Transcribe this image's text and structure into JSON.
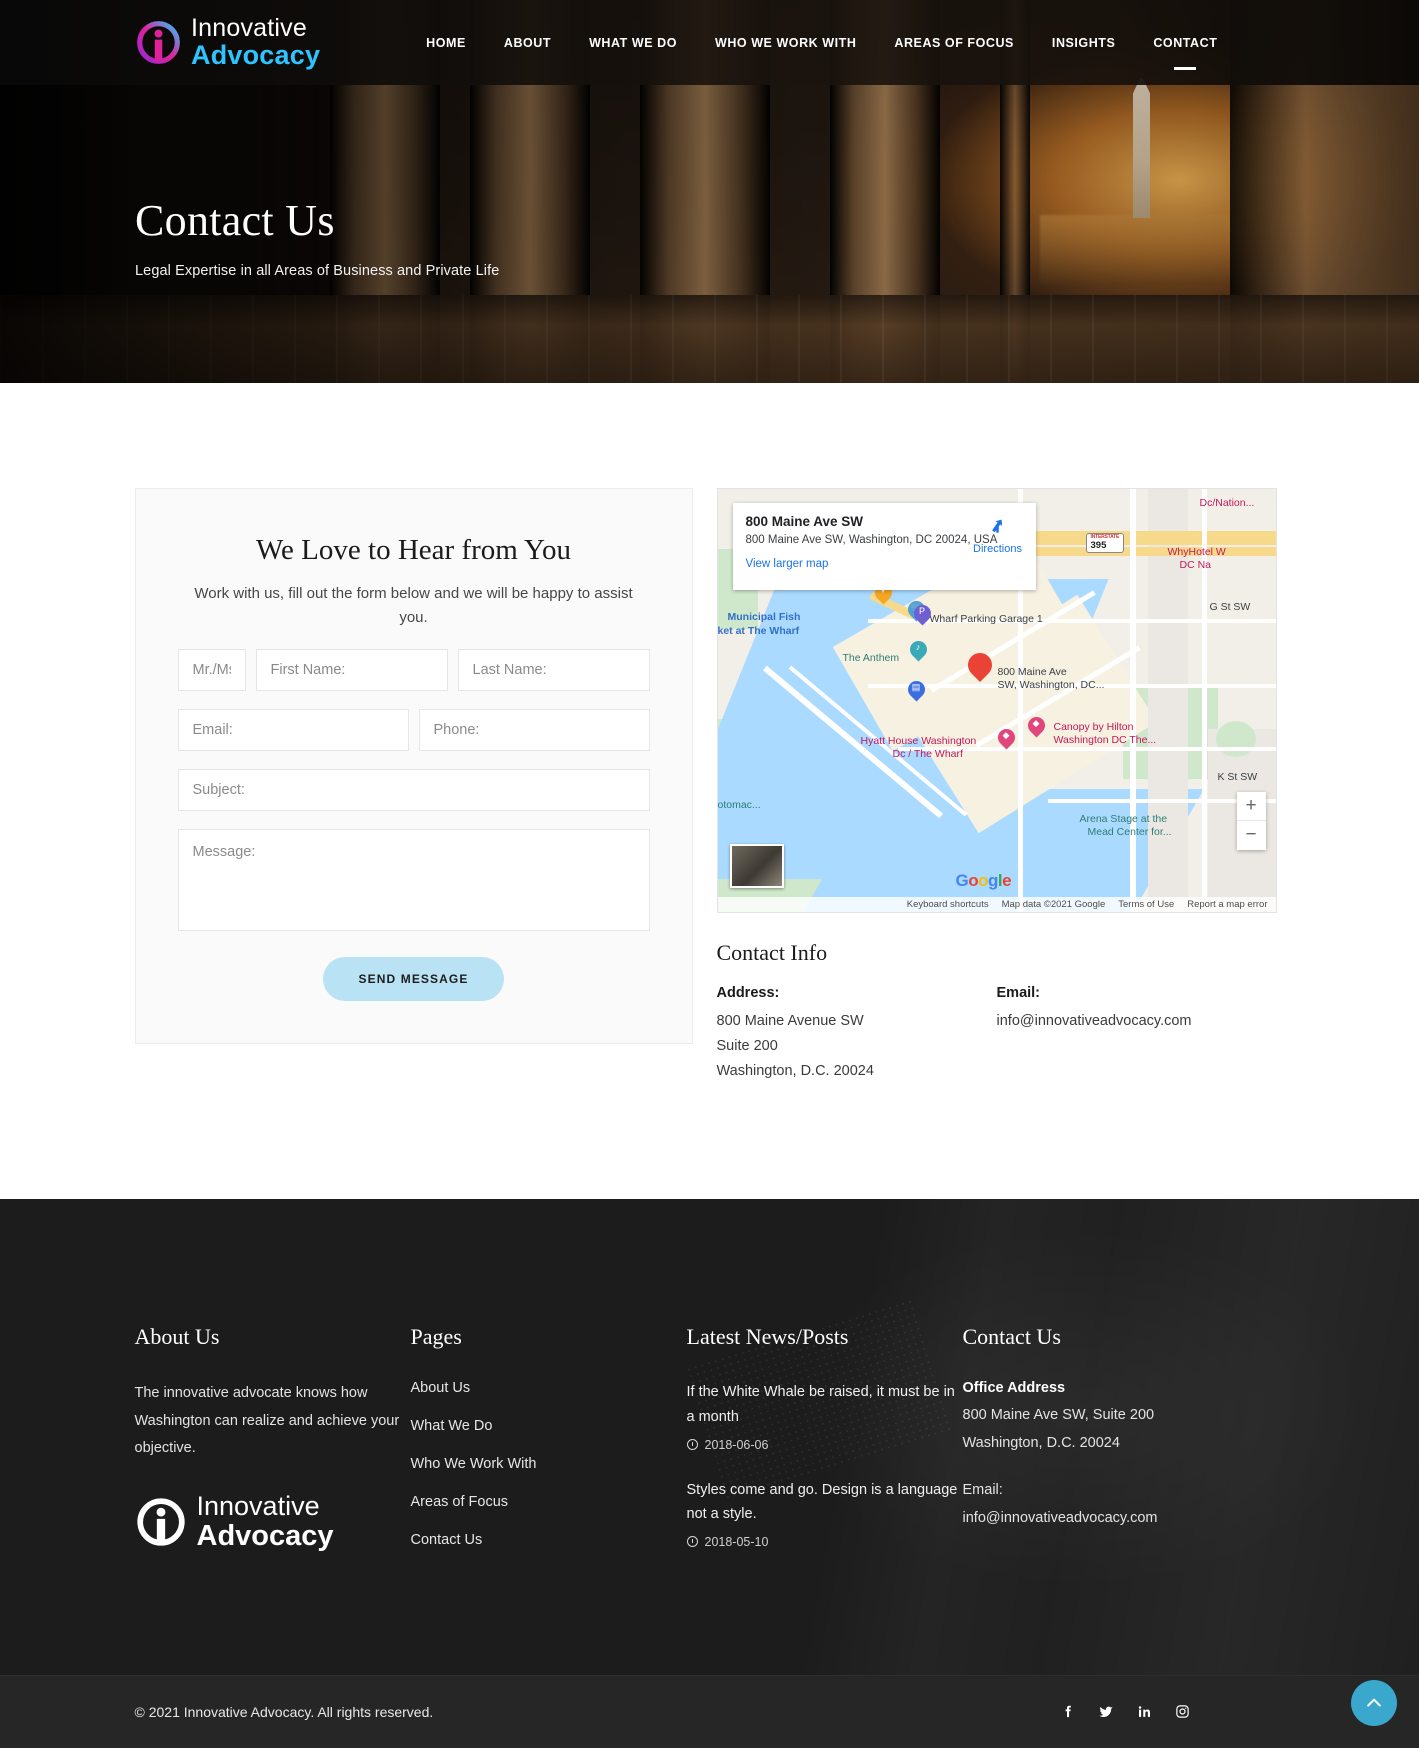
{
  "brand": {
    "name_line1": "Innovative",
    "name_line2": "Advocacy",
    "accent_blue": "#2ec4ff",
    "accent_magenta": "#d6219c"
  },
  "nav": {
    "items": [
      {
        "label": "HOME",
        "active": false
      },
      {
        "label": "ABOUT",
        "active": false
      },
      {
        "label": "WHAT WE DO",
        "active": false
      },
      {
        "label": "WHO WE WORK WITH",
        "active": false
      },
      {
        "label": "AREAS OF FOCUS",
        "active": false
      },
      {
        "label": "INSIGHTS",
        "active": false
      },
      {
        "label": "CONTACT",
        "active": true
      }
    ]
  },
  "hero": {
    "title": "Contact Us",
    "subtitle": "Legal Expertise in all Areas of Business and Private Life"
  },
  "form": {
    "title": "We Love to Hear from You",
    "description": "Work with us, fill out the form below and we will be happy to assist you.",
    "fields": {
      "title_placeholder": "Mr./Ms.",
      "first_name_placeholder": "First Name:",
      "last_name_placeholder": "Last Name:",
      "email_placeholder": "Email:",
      "phone_placeholder": "Phone:",
      "subject_placeholder": "Subject:",
      "message_placeholder": "Message:"
    },
    "submit_label": "SEND MESSAGE",
    "submit_color": "#b9e3f5"
  },
  "map": {
    "card": {
      "title": "800 Maine Ave SW",
      "address": "800 Maine Ave SW, Washington, DC 20024, USA",
      "view_larger": "View larger map",
      "directions_label": "Directions"
    },
    "labels": {
      "municipal_fish": "Municipal Fish",
      "municipal_fish2": "ket at The Wharf",
      "wharf_parking": "Wharf Parking Garage 1",
      "the_anthem": "The Anthem",
      "marker_place": "800 Maine Ave",
      "marker_place2": "SW, Washington, DC...",
      "canopy": "Canopy by Hilton",
      "canopy2": "Washington DC The...",
      "hyatt": "Hyatt House Washington",
      "hyatt2": "Dc / The Wharf",
      "potomac": "otomac...",
      "arena": "Arena Stage at the",
      "arena2": "Mead Center for...",
      "g_st": "G St SW",
      "k_st": "K St SW",
      "dc_nation": "Dc/Nation...",
      "whyhotel": "WhyHotel W",
      "whyhotel2": "DC Na",
      "highway": "395",
      "highway_badge": "INTERSTATE"
    },
    "controls": {
      "zoom_in": "+",
      "zoom_out": "−"
    },
    "attribution": {
      "logo": "Google",
      "keyboard_shortcuts": "Keyboard shortcuts",
      "map_data": "Map data ©2021 Google",
      "terms": "Terms of Use",
      "report": "Report a map error"
    }
  },
  "contact_info": {
    "heading": "Contact Info",
    "address_label": "Address:",
    "address_lines": [
      "800 Maine Avenue SW",
      "Suite 200",
      "Washington, D.C. 20024"
    ],
    "email_label": "Email:",
    "email": "info@innovativeadvocacy.com"
  },
  "footer": {
    "about": {
      "heading": "About Us",
      "text": "The innovative advocate knows how Washington can realize and achieve your objective."
    },
    "pages": {
      "heading": "Pages",
      "links": [
        "About Us",
        "What We Do",
        "Who We Work With",
        "Areas of Focus",
        "Contact Us"
      ]
    },
    "news": {
      "heading": "Latest News/Posts",
      "posts": [
        {
          "title": "If the White Whale be raised, it must be in a month",
          "date": "2018-06-06"
        },
        {
          "title": "Styles come and go. Design is a language not a style.",
          "date": "2018-05-10"
        }
      ]
    },
    "contact": {
      "heading": "Contact Us",
      "office_label": "Office Address",
      "office_lines": [
        "800 Maine Ave SW, Suite 200",
        "Washington, D.C. 20024"
      ],
      "email_label": "Email:",
      "email": "info@innovativeadvocacy.com"
    },
    "bottom": {
      "copyright": "© 2021 Innovative Advocacy. All rights reserved.",
      "socials": [
        "facebook-icon",
        "twitter-icon",
        "linkedin-icon",
        "instagram-icon"
      ]
    },
    "scroll_top": {
      "icon": "chevron-up-icon",
      "color": "#3aa7cc"
    }
  }
}
